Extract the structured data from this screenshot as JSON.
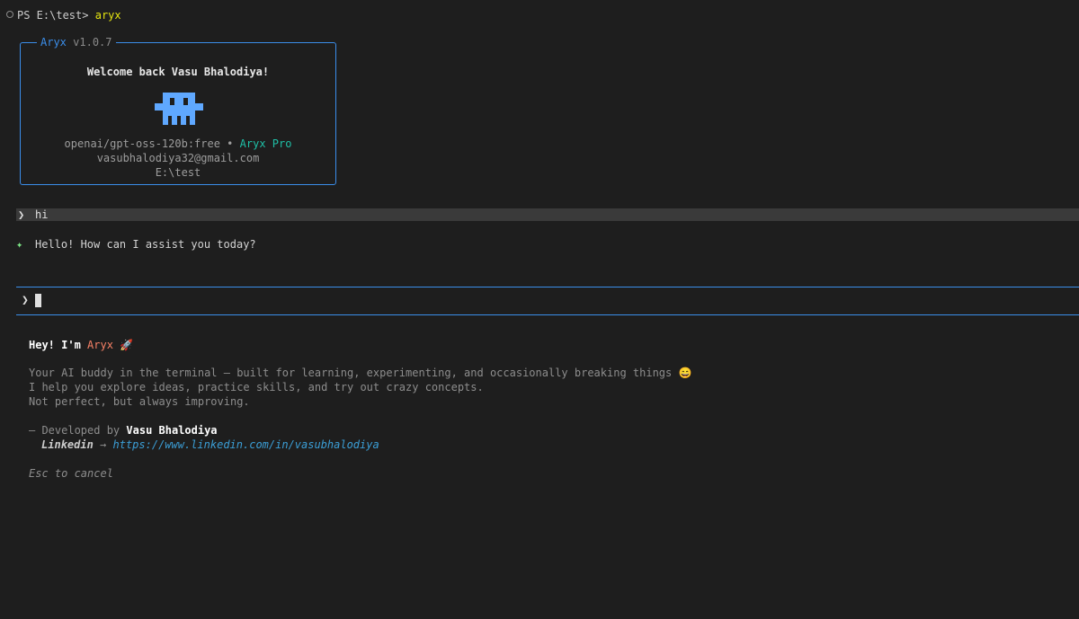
{
  "terminal": {
    "prompt_path": "PS E:\\test>",
    "prompt_command": "aryx"
  },
  "welcome_box": {
    "app_name": "Aryx",
    "version": "v1.0.7",
    "welcome_text": "Welcome back Vasu Bhalodiya!",
    "model": "openai/gpt-oss-120b:free",
    "separator": "•",
    "plan": "Aryx Pro",
    "email": "vasubhalodiya32@gmail.com",
    "cwd": "E:\\test",
    "mascot_icon": "pixel-robot-icon",
    "mascot_color": "#5fa8ff",
    "border_color": "#3b8eea"
  },
  "chat": {
    "user_marker": "❯",
    "user_message": "hi",
    "ai_marker": "✦",
    "ai_message": "Hello! How can I assist you today?"
  },
  "input": {
    "chevron": "❯",
    "value": ""
  },
  "info": {
    "greeting_prefix": "Hey! I'm",
    "greeting_name": "Aryx",
    "rocket_icon": "🚀",
    "description_line1": "Your AI buddy in the terminal — built for learning, experimenting, and occasionally breaking things",
    "description_line1_emoji": "😄",
    "description_line2": "I help you explore ideas, practice skills, and try out crazy concepts.",
    "description_line3": "Not perfect, but always improving.",
    "developed_by_prefix": "— Developed by",
    "developer_name": "Vasu Bhalodiya",
    "linkedin_label": "Linkedin",
    "linkedin_arrow": "→",
    "linkedin_url": "https://www.linkedin.com/in/vasubhalodiya",
    "esc_hint": "Esc to cancel"
  }
}
